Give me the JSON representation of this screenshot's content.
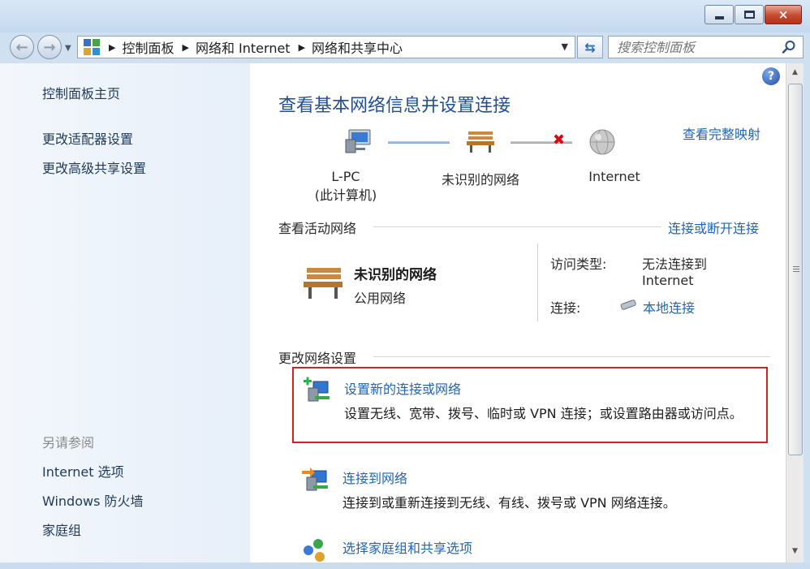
{
  "window": {
    "close_glyph": "×"
  },
  "address": {
    "crumbs": [
      "控制面板",
      "网络和 Internet",
      "网络和共享中心"
    ],
    "search_placeholder": "搜索控制面板"
  },
  "sidebar": {
    "home": "控制面板主页",
    "items": [
      "更改适配器设置",
      "更改高级共享设置"
    ],
    "see_also_title": "另请参阅",
    "see_also": [
      "Internet 选项",
      "Windows 防火墙",
      "家庭组"
    ]
  },
  "main": {
    "help_glyph": "?",
    "title": "查看基本网络信息并设置连接",
    "full_map": "查看完整映射",
    "map": {
      "computer": "L-PC",
      "computer_sub": "(此计算机)",
      "network": "未识别的网络",
      "internet": "Internet",
      "broken_glyph": "✖"
    },
    "active": {
      "header": "查看活动网络",
      "connect_link": "连接或断开连接",
      "name": "未识别的网络",
      "type": "公用网络",
      "access_label": "访问类型:",
      "access_value_1": "无法连接到",
      "access_value_2": "Internet",
      "conn_label": "连接:",
      "conn_value": "本地连接"
    },
    "change": {
      "header": "更改网络设置",
      "tasks": [
        {
          "link": "设置新的连接或网络",
          "desc": "设置无线、宽带、拨号、临时或 VPN 连接；或设置路由器或访问点。"
        },
        {
          "link": "连接到网络",
          "desc": "连接到或重新连接到无线、有线、拨号或 VPN 网络连接。"
        },
        {
          "link": "选择家庭组和共享选项",
          "desc": ""
        }
      ]
    }
  },
  "colors": {
    "link": "#1f65b8",
    "title": "#1f4e9b",
    "highlight": "#d0202a"
  }
}
